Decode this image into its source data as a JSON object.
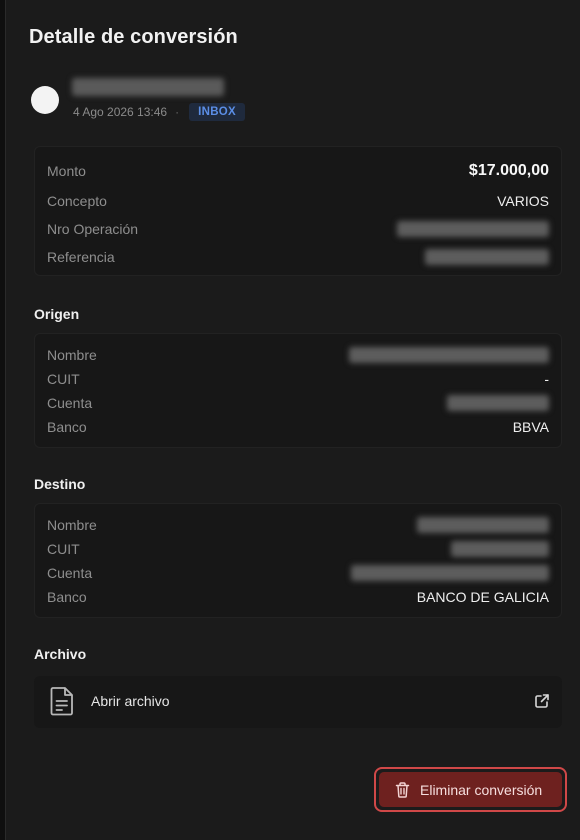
{
  "panel": {
    "title": "Detalle de conversión"
  },
  "header": {
    "datetime": "4 Ago 2026 13:46",
    "separator": "·",
    "badge": "INBOX"
  },
  "summary": {
    "rows": [
      {
        "label": "Monto",
        "value": "$17.000,00"
      },
      {
        "label": "Concepto",
        "value": "VARIOS"
      },
      {
        "label": "Nro Operación",
        "value": ""
      },
      {
        "label": "Referencia",
        "value": ""
      }
    ]
  },
  "origen": {
    "title": "Origen",
    "rows": [
      {
        "label": "Nombre",
        "value": ""
      },
      {
        "label": "CUIT",
        "value": "-"
      },
      {
        "label": "Cuenta",
        "value": ""
      },
      {
        "label": "Banco",
        "value": "BBVA"
      }
    ]
  },
  "destino": {
    "title": "Destino",
    "rows": [
      {
        "label": "Nombre",
        "value": ""
      },
      {
        "label": "CUIT",
        "value": ""
      },
      {
        "label": "Cuenta",
        "value": ""
      },
      {
        "label": "Banco",
        "value": "BANCO DE GALICIA"
      }
    ]
  },
  "archivo": {
    "title": "Archivo",
    "open_label": "Abrir archivo",
    "file_icon": "document-icon",
    "open_icon": "external-link-icon"
  },
  "actions": {
    "delete_label": "Eliminar conversión",
    "delete_icon": "trash-icon"
  },
  "colors": {
    "badge": "#5b8ee6",
    "delete_bg": "#6e211f",
    "delete_border": "#d04848"
  }
}
